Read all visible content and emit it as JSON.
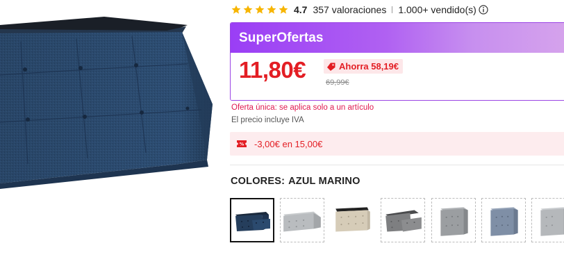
{
  "product": {
    "image_icon": "navy-storage-ottoman-image",
    "image_color": "#2b4a6e"
  },
  "rating": {
    "value": "4.7",
    "stars": 5,
    "star_color": "#f7b500",
    "reviews": "357 valoraciones",
    "sold": "1.000+ vendido(s)",
    "info_icon": "info-icon"
  },
  "offer": {
    "title": "SuperOfertas",
    "header_color": "#9a3ef5",
    "price": "11,80€",
    "save_label": "Ahorra 58,19€",
    "old_price": "69,99€",
    "price_color": "#e31e24"
  },
  "notes": {
    "limit": "Oferta única: se aplica solo a un artículo",
    "vat": "El precio incluye IVA"
  },
  "coupon": {
    "icon": "coupon-icon",
    "text": "-3,00€ en 15,00€"
  },
  "colors": {
    "label": "COLORES:",
    "selected": "AZUL MARINO",
    "swatches": [
      {
        "name": "navy-bench",
        "color": "#253e5c",
        "selected": true
      },
      {
        "name": "light-grey-bench",
        "color": "#b9bcbf",
        "selected": false
      },
      {
        "name": "beige-bench",
        "color": "#d6ccb8",
        "selected": false
      },
      {
        "name": "dark-grey-bench",
        "color": "#7e7f81",
        "selected": false
      },
      {
        "name": "grey-cube",
        "color": "#9b9ea1",
        "selected": false
      },
      {
        "name": "blue-grey-cube",
        "color": "#7f8fa6",
        "selected": false
      },
      {
        "name": "light-grey-cube",
        "color": "#b5b8bb",
        "selected": false
      }
    ]
  }
}
